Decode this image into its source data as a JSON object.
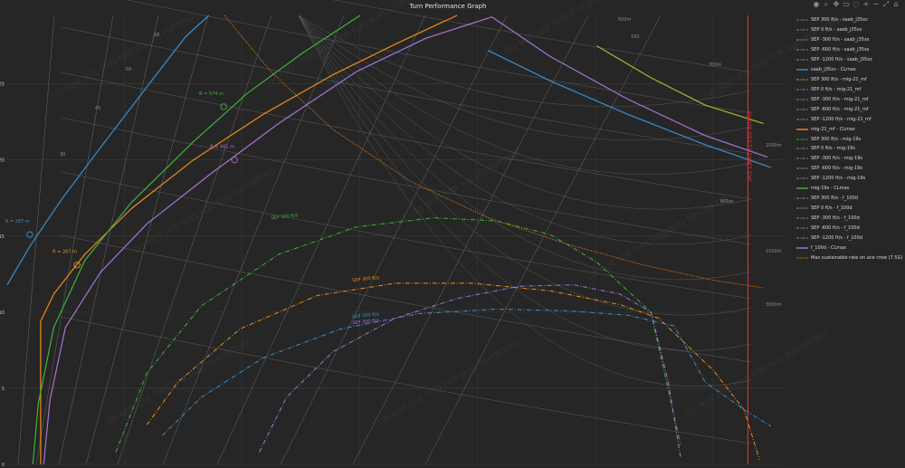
{
  "title": "Turn Performance Graph",
  "watermark": "DO NOT USE THIS FOR BUG REPORTING",
  "modebar_icons": [
    "camera-icon",
    "zoom-icon",
    "pan-icon",
    "box-select-icon",
    "lasso-icon",
    "zoom-in-icon",
    "zoom-out-icon",
    "autoscale-icon",
    "reset-axes-icon"
  ],
  "chart_data": {
    "type": "line",
    "title": "Turn Performance Graph",
    "xlabel": "",
    "ylabel": "",
    "y_ticks": [
      0,
      5,
      10,
      15,
      20,
      25
    ],
    "ylim": [
      0,
      29.5
    ],
    "xlim": [
      0,
      1
    ],
    "grid": true,
    "legend_position": "right",
    "radius_labels": [
      "30",
      "40",
      "50",
      "60",
      "160",
      "600m",
      "700m",
      "800m",
      "1000m",
      "1500m",
      "3000m"
    ],
    "turn_radius_annotations": [
      {
        "text": "R = 287 m",
        "x": 0.029,
        "y": 15.1,
        "color": "#3a8fd0"
      },
      {
        "text": "R = 267 m",
        "x": 0.09,
        "y": 13.1,
        "color": "#f08a1c"
      },
      {
        "text": "R = 574 m",
        "x": 0.279,
        "y": 23.5,
        "color": "#3fb23f"
      },
      {
        "text": "R = 461 m",
        "x": 0.293,
        "y": 20.0,
        "color": "#a774d6"
      }
    ],
    "sep_labels": [
      {
        "text": "SEP 300 ft/s",
        "x": 0.34,
        "y": 16.1,
        "color": "#3fb23f"
      },
      {
        "text": "SEP 300 ft/s",
        "x": 0.445,
        "y": 12.0,
        "color": "#f08a1c"
      },
      {
        "text": "SEP 300 ft/s",
        "x": 0.445,
        "y": 9.6,
        "color": "#3a8fd0"
      },
      {
        "text": "SEP 300 ft/s",
        "x": 0.445,
        "y": 9.2,
        "color": "#a774d6"
      }
    ],
    "limit_label": "IAS LIMIT (1350 km/h)",
    "limit_x": 0.955,
    "series": [
      {
        "name": "saab_j35xs - CLmax",
        "color": "#3a8fd0",
        "dash": "solid",
        "x": [
          0,
          0.03,
          0.07,
          0.12,
          0.18,
          0.23,
          0.26
        ],
        "y": [
          11.8,
          14.4,
          17.4,
          20.8,
          24.8,
          28.1,
          29.5
        ]
      },
      {
        "name": "saab_j35xs - CLmax",
        "color": "#3a8fd0",
        "dash": "solid",
        "x": [
          0.62,
          0.7,
          0.8,
          0.9,
          0.985
        ],
        "y": [
          27.2,
          25.2,
          23.0,
          21.0,
          19.5
        ]
      },
      {
        "name": "mig-21_mf - CLmax",
        "color": "#f08a1c",
        "dash": "solid",
        "x": [
          0.043,
          0.043,
          0.06,
          0.1,
          0.16,
          0.24,
          0.33,
          0.42,
          0.5,
          0.55,
          0.58
        ],
        "y": [
          0,
          9.4,
          11.2,
          13.8,
          16.8,
          20.0,
          23.0,
          25.6,
          27.6,
          28.8,
          29.5
        ]
      },
      {
        "name": "mig-19s - CLmax",
        "color": "#3fb23f",
        "dash": "solid",
        "x": [
          0.033,
          0.04,
          0.06,
          0.1,
          0.16,
          0.24,
          0.31,
          0.38,
          0.455
        ],
        "y": [
          0,
          4.0,
          9.0,
          13.4,
          17.2,
          21.2,
          24.4,
          27.0,
          29.5
        ]
      },
      {
        "name": "mig-19s - CLmax",
        "color": "#a8b82a",
        "dash": "solid",
        "x": [
          0.76,
          0.83,
          0.9,
          0.975
        ],
        "y": [
          27.5,
          25.4,
          23.6,
          22.4
        ]
      },
      {
        "name": "f_100d - CLmax",
        "color": "#a774d6",
        "dash": "solid",
        "x": [
          0.047,
          0.055,
          0.075,
          0.12,
          0.18,
          0.26,
          0.35,
          0.45,
          0.54,
          0.625
        ],
        "y": [
          0,
          4.2,
          9.0,
          12.6,
          15.8,
          19.0,
          22.4,
          25.8,
          28.0,
          29.4
        ]
      },
      {
        "name": "f_100d - CLmax",
        "color": "#a774d6",
        "dash": "solid",
        "x": [
          0.625,
          0.7,
          0.8,
          0.9,
          0.98
        ],
        "y": [
          29.4,
          26.8,
          24.0,
          21.6,
          20.2
        ]
      },
      {
        "name": "Max sustainable rate on ace crew (7.5G)",
        "color": "#f08a1c",
        "dash": "dotted",
        "x": [
          0.28,
          0.34,
          0.42,
          0.52,
          0.62,
          0.72,
          0.82,
          0.91,
          0.975
        ],
        "y": [
          29.5,
          25.8,
          22.0,
          18.6,
          16.2,
          14.5,
          13.1,
          12.1,
          11.6
        ]
      },
      {
        "name": "SEP 300 ft/s - mig-19s",
        "color": "#3fb23f",
        "dash": "dashdot",
        "x": [
          0.14,
          0.18,
          0.25,
          0.35,
          0.45,
          0.55,
          0.63,
          0.7,
          0.76,
          0.83,
          0.868
        ],
        "y": [
          0.8,
          6.0,
          10.4,
          13.8,
          15.6,
          16.2,
          16.0,
          15.1,
          13.3,
          10.0,
          1.3
        ]
      },
      {
        "name": "SEP 300 ft/s - mig-21_mf",
        "color": "#f08a1c",
        "dash": "dashdot",
        "x": [
          0.18,
          0.22,
          0.3,
          0.4,
          0.5,
          0.6,
          0.7,
          0.79,
          0.84,
          0.91,
          0.95,
          0.97
        ],
        "y": [
          2.6,
          5.4,
          8.9,
          11.1,
          11.9,
          11.9,
          11.4,
          10.5,
          9.6,
          6.2,
          3.6,
          0.3
        ]
      },
      {
        "name": "SEP 300 ft/s - saab_j35xs",
        "color": "#3a8fd0",
        "dash": "dashdot",
        "x": [
          0.2,
          0.25,
          0.33,
          0.43,
          0.53,
          0.63,
          0.72,
          0.8,
          0.86,
          0.9,
          0.95,
          0.985
        ],
        "y": [
          1.9,
          4.4,
          7.0,
          8.9,
          9.9,
          10.2,
          10.1,
          9.8,
          9.1,
          5.4,
          3.6,
          2.5
        ]
      },
      {
        "name": "SEP 300 ft/s - f_100d",
        "color": "#a774d6",
        "dash": "dashdot",
        "x": [
          0.325,
          0.36,
          0.42,
          0.5,
          0.58,
          0.66,
          0.73,
          0.79,
          0.83,
          0.852,
          0.868
        ],
        "y": [
          0.8,
          4.4,
          7.4,
          9.6,
          10.9,
          11.7,
          11.8,
          11.2,
          10.0,
          5.5,
          0.5
        ]
      }
    ],
    "legend": [
      {
        "name": "SEP 300 ft/s - saab_j35xs",
        "color": "#3a8fd0",
        "dash": "dashdot"
      },
      {
        "name": "SEP 0 ft/s - saab_j35xs",
        "color": "#8a8a8a",
        "dash": "dashdot"
      },
      {
        "name": "SEP -300 ft/s - saab_j35xs",
        "color": "#8a8a8a",
        "dash": "dashdot"
      },
      {
        "name": "SEP -600 ft/s - saab_j35xs",
        "color": "#8a8a8a",
        "dash": "dashdot"
      },
      {
        "name": "SEP -1200 ft/s - saab_j35xs",
        "color": "#8a8a8a",
        "dash": "dashdot"
      },
      {
        "name": "saab_j35xs - CLmax",
        "color": "#3a8fd0",
        "dash": "solid"
      },
      {
        "name": "SEP 300 ft/s - mig-21_mf",
        "color": "#f08a1c",
        "dash": "dashdot"
      },
      {
        "name": "SEP 0 ft/s - mig-21_mf",
        "color": "#8a8a8a",
        "dash": "dashdot"
      },
      {
        "name": "SEP -300 ft/s - mig-21_mf",
        "color": "#8a8a8a",
        "dash": "dashdot"
      },
      {
        "name": "SEP -600 ft/s - mig-21_mf",
        "color": "#8a8a8a",
        "dash": "dashdot"
      },
      {
        "name": "SEP -1200 ft/s - mig-21_mf",
        "color": "#8a8a8a",
        "dash": "dashdot"
      },
      {
        "name": "mig-21_mf - CLmax",
        "color": "#f08a1c",
        "dash": "solid"
      },
      {
        "name": "SEP 300 ft/s - mig-19s",
        "color": "#3fb23f",
        "dash": "dashdot"
      },
      {
        "name": "SEP 0 ft/s - mig-19s",
        "color": "#8a8a8a",
        "dash": "dashdot"
      },
      {
        "name": "SEP -300 ft/s - mig-19s",
        "color": "#8a8a8a",
        "dash": "dashdot"
      },
      {
        "name": "SEP -600 ft/s - mig-19s",
        "color": "#8a8a8a",
        "dash": "dashdot"
      },
      {
        "name": "SEP -1200 ft/s - mig-19s",
        "color": "#8a8a8a",
        "dash": "dashdot"
      },
      {
        "name": "mig-19s - CLmax",
        "color": "#3fb23f",
        "dash": "solid"
      },
      {
        "name": "SEP 300 ft/s - f_100d",
        "color": "#a774d6",
        "dash": "dashdot"
      },
      {
        "name": "SEP 0 ft/s - f_100d",
        "color": "#8a8a8a",
        "dash": "dashdot"
      },
      {
        "name": "SEP -300 ft/s - f_100d",
        "color": "#8a8a8a",
        "dash": "dashdot"
      },
      {
        "name": "SEP -600 ft/s - f_100d",
        "color": "#8a8a8a",
        "dash": "dashdot"
      },
      {
        "name": "SEP -1200 ft/s - f_100d",
        "color": "#8a8a8a",
        "dash": "dashdot"
      },
      {
        "name": "f_100d - CLmax",
        "color": "#a774d6",
        "dash": "solid"
      },
      {
        "name": "Max sustainable rate on ace crew (7.5G)",
        "color": "#f08a1c",
        "dash": "dotted"
      }
    ]
  }
}
